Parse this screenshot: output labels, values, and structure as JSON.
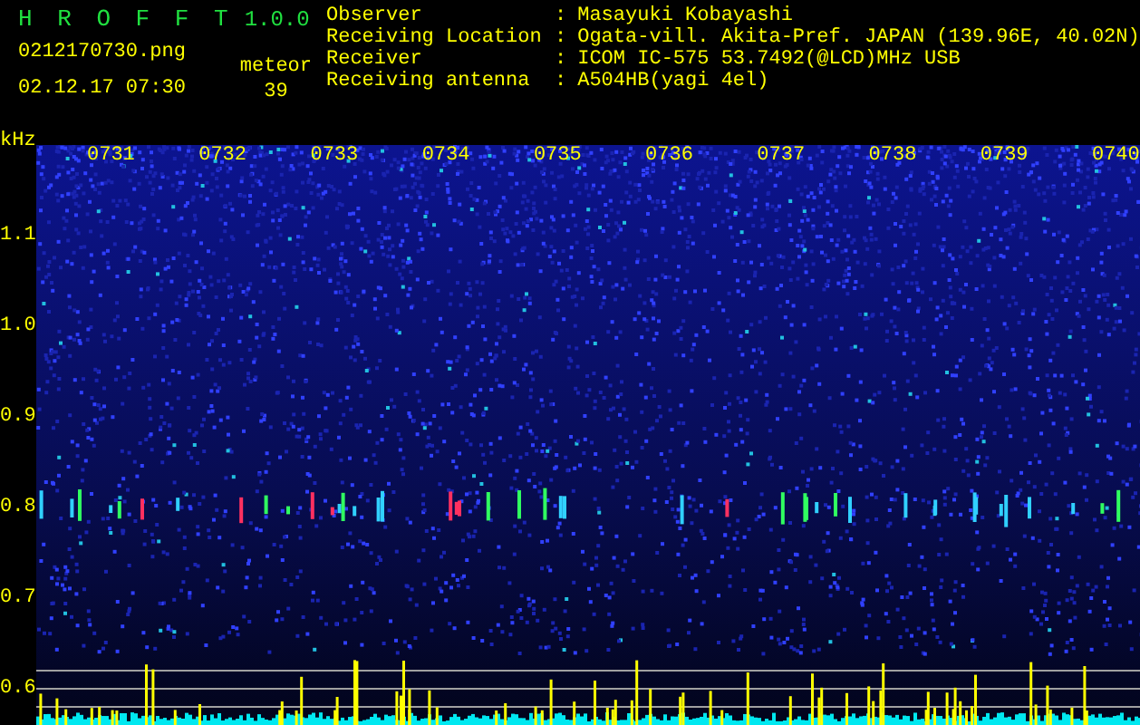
{
  "header": {
    "title": "H R O F F T",
    "version": "1.0.0",
    "filename": "0212170730.png",
    "datetime": "02.12.17 07:30",
    "meteor_label": "meteor",
    "meteor_count": "39"
  },
  "info": [
    {
      "label": "Observer",
      "separator": ":",
      "value": "Masayuki Kobayashi"
    },
    {
      "label": "Receiving Location",
      "separator": ":",
      "value": "Ogata-vill. Akita-Pref. JAPAN (139.96E, 40.02N)"
    },
    {
      "label": "Receiver",
      "separator": ":",
      "value": "ICOM IC-575 53.7492(@LCD)MHz USB"
    },
    {
      "label": "Receiving antenna",
      "separator": ":",
      "value": "A504HB(yagi 4el)"
    }
  ],
  "spectrogram": {
    "unit": "kHz",
    "time_labels": [
      "0731",
      "0732",
      "0733",
      "0734",
      "0735",
      "0736",
      "0737",
      "0738",
      "0739",
      "0740"
    ],
    "freq_labels": [
      "1.1",
      "1.0",
      "0.9",
      "0.8",
      "0.7",
      "0.6"
    ]
  }
}
